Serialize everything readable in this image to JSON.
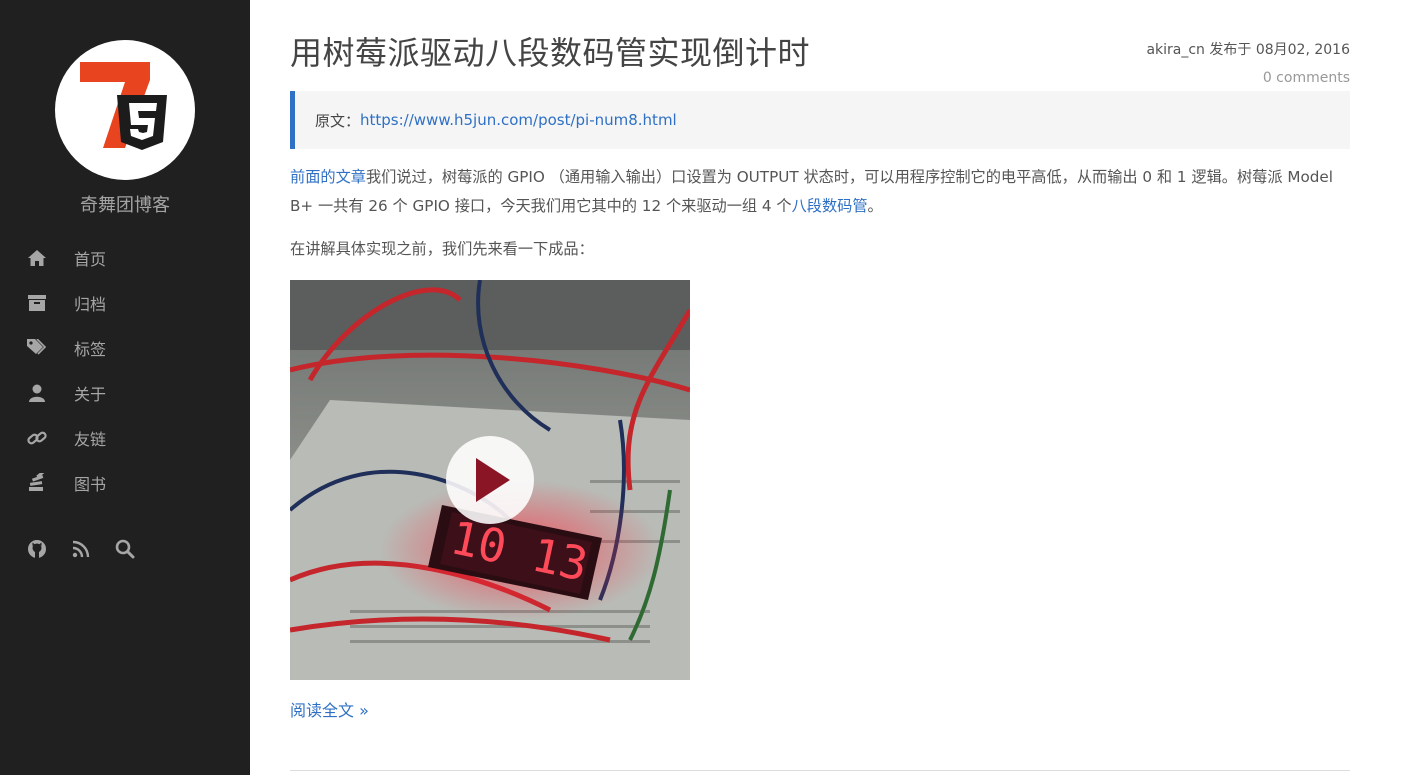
{
  "sidebar": {
    "logo": {
      "text": "75",
      "icon": "h5-logo"
    },
    "site_name": "奇舞团博客",
    "nav": [
      {
        "label": "首页",
        "icon": "home-icon"
      },
      {
        "label": "归档",
        "icon": "archive-icon"
      },
      {
        "label": "标签",
        "icon": "tags-icon"
      },
      {
        "label": "关于",
        "icon": "user-icon"
      },
      {
        "label": "友链",
        "icon": "link-icon"
      },
      {
        "label": "图书",
        "icon": "book-icon"
      }
    ],
    "social": [
      "github-icon",
      "rss-icon",
      "search-icon"
    ]
  },
  "post": {
    "title": "用树莓派驱动八段数码管实现倒计时",
    "meta": {
      "author": "akira_cn",
      "published_label": "发布于",
      "date": "08月02, 2016",
      "comments": "0 comments"
    },
    "quote": {
      "prefix": "原文：",
      "link": "https://www.h5jun.com/post/pi-num8.html"
    },
    "paragraph1": {
      "link1": "前面的文章",
      "text1": "我们说过，树莓派的 GPIO （通用输入输出）口设置为 OUTPUT 状态时，可以用程序控制它的电平高低，从而输出 0 和 1 逻辑。树莓派 Model B+ 一共有 26 个 GPIO 接口，今天我们用它其中的 12 个来驱动一组 4 个",
      "link2": "八段数码管",
      "text2": "。"
    },
    "paragraph2": "在讲解具体实现之前，我们先来看一下成品：",
    "video": {
      "display_text": "10 13",
      "icon": "play-icon"
    },
    "read_more": "阅读全文 »"
  },
  "colors": {
    "sidebar_bg": "#202020",
    "link": "#2f70c4",
    "quote_border": "#2f70c4",
    "logo_orange": "#e8441f"
  }
}
